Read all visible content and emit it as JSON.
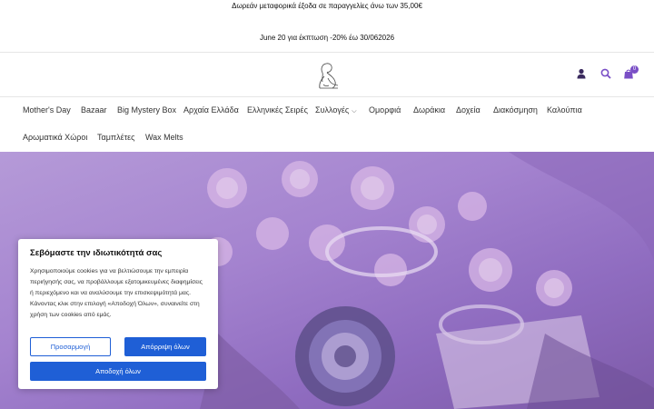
{
  "announcement": {
    "line1": "Δωρεάν μεταφορικά έξοδα σε παραγγελίες άνω των 35,00€",
    "line2": "June 20 για έκπτωση -20% έω 30/062026"
  },
  "header": {
    "logo_icon": "woman-line-art-logo",
    "account_icon": "user-icon",
    "search_icon": "search-icon",
    "cart_icon": "shopping-bag-icon",
    "cart_count": "0",
    "accent_color": "#7a4fc6"
  },
  "nav": {
    "items": [
      "Mother's Day",
      "Bazaar",
      "Big Mystery Box",
      "Αρχαία Ελλάδα",
      "Ελληνικές Σειρές",
      "Συλλογές",
      "Ομορφιά",
      "Δωράκια",
      "Δοχεία",
      "Διακόσμηση",
      "Καλούπια",
      "Αρωματικά Χώροι",
      "Ταμπλέτες",
      "Wax Melts"
    ]
  },
  "cookie": {
    "title": "Σεβόμαστε την ιδιωτικότητά σας",
    "text": "Χρησιμοποιούμε cookies για να βελτιώσουμε την εμπειρία περιήγησής σας, να προβάλλουμε εξατομικευμένες διαφημίσεις ή περιεχόμενο και να αναλύσουμε την επισκεψιμότητά μας. Κάνοντας κλικ στην επιλογή «Αποδοχή Όλων», συναινείτε στη χρήση των cookies από εμάς.",
    "customize": "Προσαρμογή",
    "reject": "Απόρριψη όλων",
    "accept": "Αποδοχή όλων",
    "button_color": "#1f5fd6"
  }
}
